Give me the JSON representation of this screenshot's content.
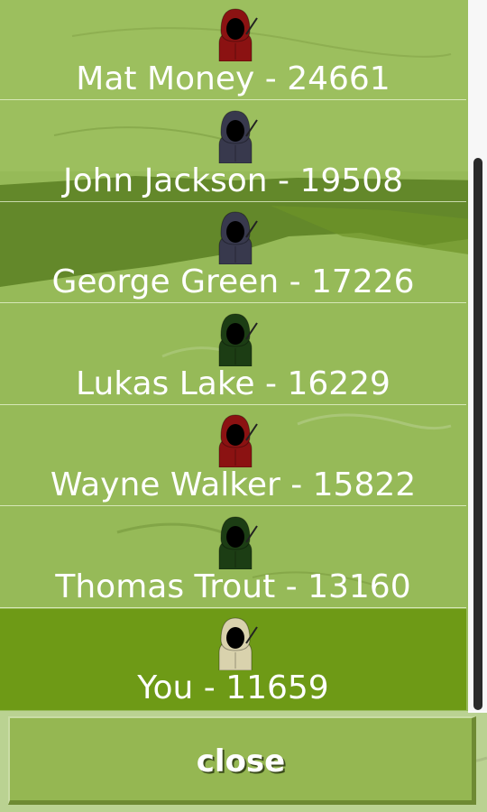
{
  "colors": {
    "grass": "#96ba58",
    "highlight_row": "#6e9a16",
    "text": "#ffffff",
    "button": "#95b752"
  },
  "leaderboard": [
    {
      "label": "Mat Money - 24661",
      "hood_color": "#8b1212",
      "icon": "hooded-fisher-icon"
    },
    {
      "label": "John Jackson - 19508",
      "hood_color": "#38394d",
      "icon": "hooded-fisher-icon"
    },
    {
      "label": "George Green - 17226",
      "hood_color": "#38394d",
      "icon": "hooded-fisher-icon"
    },
    {
      "label": "Lukas Lake - 16229",
      "hood_color": "#1c3d14",
      "icon": "hooded-fisher-icon"
    },
    {
      "label": "Wayne Walker - 15822",
      "hood_color": "#8b1212",
      "icon": "hooded-fisher-icon"
    },
    {
      "label": "Thomas Trout - 13160",
      "hood_color": "#1c3d14",
      "icon": "hooded-fisher-icon"
    },
    {
      "label": "You - 11659",
      "hood_color": "#d9d2ad",
      "icon": "hooded-fisher-icon",
      "is_you": true
    }
  ],
  "close_button": {
    "label": "close"
  }
}
